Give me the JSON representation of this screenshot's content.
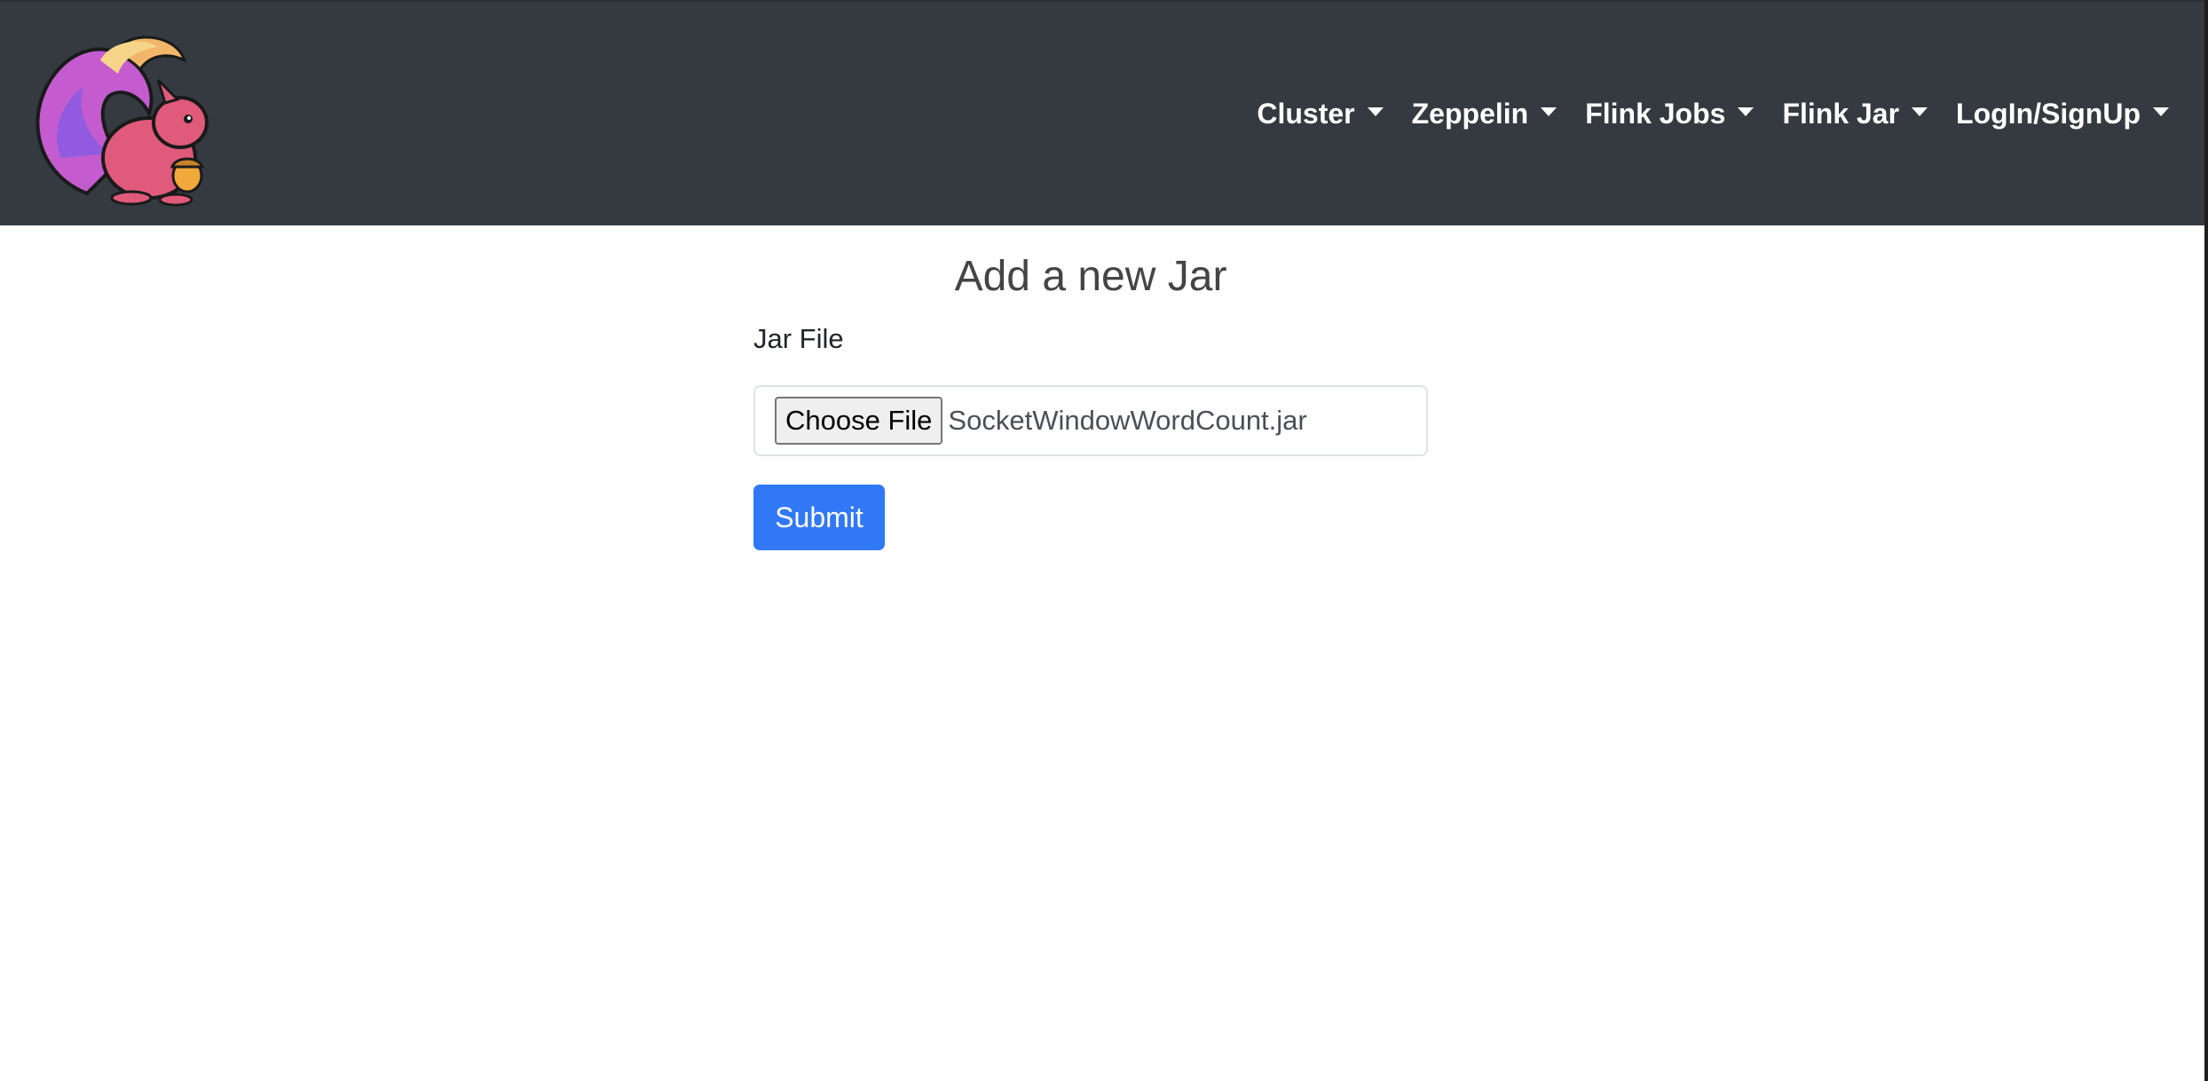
{
  "navbar": {
    "logo_icon": "apache-flink-squirrel-logo",
    "items": [
      {
        "label": "Cluster",
        "icon": "caret-down-icon"
      },
      {
        "label": "Zeppelin",
        "icon": "caret-down-icon"
      },
      {
        "label": "Flink Jobs",
        "icon": "caret-down-icon"
      },
      {
        "label": "Flink Jar",
        "icon": "caret-down-icon"
      },
      {
        "label": "LogIn/SignUp",
        "icon": "caret-down-icon"
      }
    ],
    "background_color": "#343a40"
  },
  "main": {
    "title": "Add a new Jar",
    "form": {
      "jar_label": "Jar File",
      "choose_file_label": "Choose File",
      "selected_file": "SocketWindowWordCount.jar",
      "submit_label": "Submit"
    },
    "accent_color": "#3178f6"
  }
}
